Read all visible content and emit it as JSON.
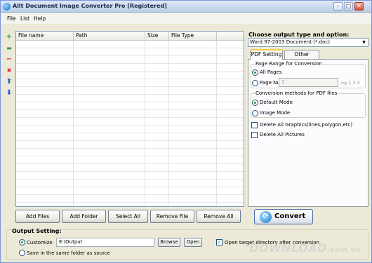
{
  "window": {
    "title": "Allt Document Image Converter Pro [Registered]",
    "title_buttons": [
      "–",
      "□",
      "✕"
    ]
  },
  "menu": [
    "File",
    "List",
    "Help"
  ],
  "toolbar": {
    "icons": [
      {
        "name": "add-icon",
        "glyph": "+",
        "color": "#2d9a2d"
      },
      {
        "name": "folder-icon",
        "glyph": "▬",
        "color": "#3d9a3d"
      },
      {
        "name": "remove-icon",
        "glyph": "−",
        "color": "#d42020"
      },
      {
        "name": "delete-icon",
        "glyph": "✖",
        "color": "#d42020"
      },
      {
        "name": "move-up-icon",
        "glyph": "⬆",
        "color": "#2a5fd0"
      },
      {
        "name": "move-down-icon",
        "glyph": "⬇",
        "color": "#2a5fd0"
      }
    ]
  },
  "file_list": {
    "columns": [
      "File name",
      "Path",
      "Size",
      "File Type"
    ],
    "rows": []
  },
  "buttons": {
    "add_files": "Add Files",
    "add_folder": "Add Folder",
    "select_all": "Select All",
    "remove_file": "Remove File",
    "remove_all": "Remove All",
    "convert": "Convert"
  },
  "output_type": {
    "title": "Choose output type and option:",
    "selected": "Word 97-2003 Document (*.doc)"
  },
  "tabs": [
    "PDF Setting",
    "Other Setting"
  ],
  "pdf_setting": {
    "page_range_title": "Page Range for Conversion",
    "all_pages": "All Pages",
    "page_number": "Page Number",
    "page_number_value": "1",
    "page_number_hint": "eg.1,3-5",
    "methods_title": "Conversion methods for PDF files",
    "default_mode": "Default Mode",
    "image_mode": "Image Mode",
    "delete_graphics": "Delete All Graphics(lines,polygon,etc)",
    "delete_pictures": "Delete All Pictures"
  },
  "output_setting": {
    "title": "Output Setting:",
    "customize": "Customize",
    "path": "E:\\Output",
    "browse": "Browse",
    "open": "Open",
    "open_after": "Open target directory after conversion",
    "same_folder": "Save in the same folder as source"
  },
  "watermark": {
    "text": "DOWNLOAD",
    "suffix": ".com.vn"
  }
}
